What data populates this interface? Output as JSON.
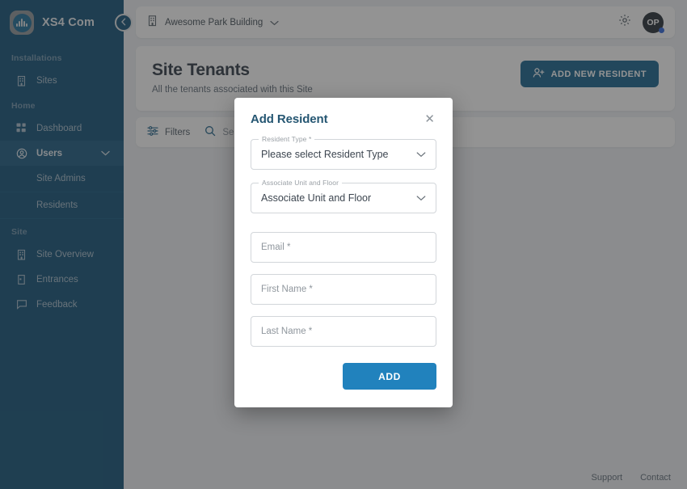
{
  "sidebar": {
    "brand": {
      "name": "XS4 Com",
      "logo_icon": "sound-wave-logo-icon"
    },
    "collapse_icon": "chevron-left-icon",
    "groups": [
      {
        "label": "Installations",
        "items": [
          {
            "label": "Sites",
            "icon": "building-icon",
            "active": false
          }
        ]
      },
      {
        "label": "Home",
        "items": [
          {
            "label": "Dashboard",
            "icon": "grid-icon",
            "active": false
          },
          {
            "label": "Users",
            "icon": "user-circle-icon",
            "active": true,
            "expanded": true,
            "children": [
              {
                "label": "Site Admins"
              },
              {
                "label": "Residents"
              }
            ]
          }
        ]
      },
      {
        "label": "Site",
        "items": [
          {
            "label": "Site Overview",
            "icon": "building-icon",
            "active": false
          },
          {
            "label": "Entrances",
            "icon": "door-icon",
            "active": false
          },
          {
            "label": "Feedback",
            "icon": "message-icon",
            "active": false
          }
        ]
      }
    ]
  },
  "topbar": {
    "site_icon": "building-icon",
    "site_name": "Awesome Park Building",
    "site_chevron": "chevron-down-icon",
    "settings_icon": "gear-icon",
    "avatar_initials": "OP",
    "avatar_status_color": "#2b62d9"
  },
  "page": {
    "title": "Site Tenants",
    "subtitle": "All the tenants associated with this Site",
    "add_button": {
      "label": "ADD NEW RESIDENT",
      "icon": "user-plus-icon"
    }
  },
  "filters": {
    "filters_label": "Filters",
    "filters_icon": "sliders-icon",
    "search_icon": "search-icon",
    "search_placeholder": "Search"
  },
  "footer": {
    "support": "Support",
    "contact": "Contact"
  },
  "modal": {
    "title": "Add Resident",
    "close_icon": "close-icon",
    "fields": [
      {
        "legend": "Resident Type *",
        "value": "Please select Resident Type",
        "type": "select",
        "chevron": "chevron-down-icon"
      },
      {
        "legend": "Associate Unit and Floor",
        "value": "Associate Unit and Floor",
        "type": "select",
        "chevron": "chevron-down-icon"
      },
      {
        "legend": "",
        "placeholder": "Email *",
        "type": "text"
      },
      {
        "legend": "",
        "placeholder": "First Name *",
        "type": "text"
      },
      {
        "legend": "",
        "placeholder": "Last Name *",
        "type": "text"
      }
    ],
    "submit_label": "ADD",
    "submit_color": "#2182bd"
  },
  "theme": {
    "sidebar_bg": "#0d4f75",
    "sidebar_active_bg": "#18597f",
    "primary": "#14618c",
    "accent": "#2182bd",
    "page_bg": "#eef1f4"
  }
}
